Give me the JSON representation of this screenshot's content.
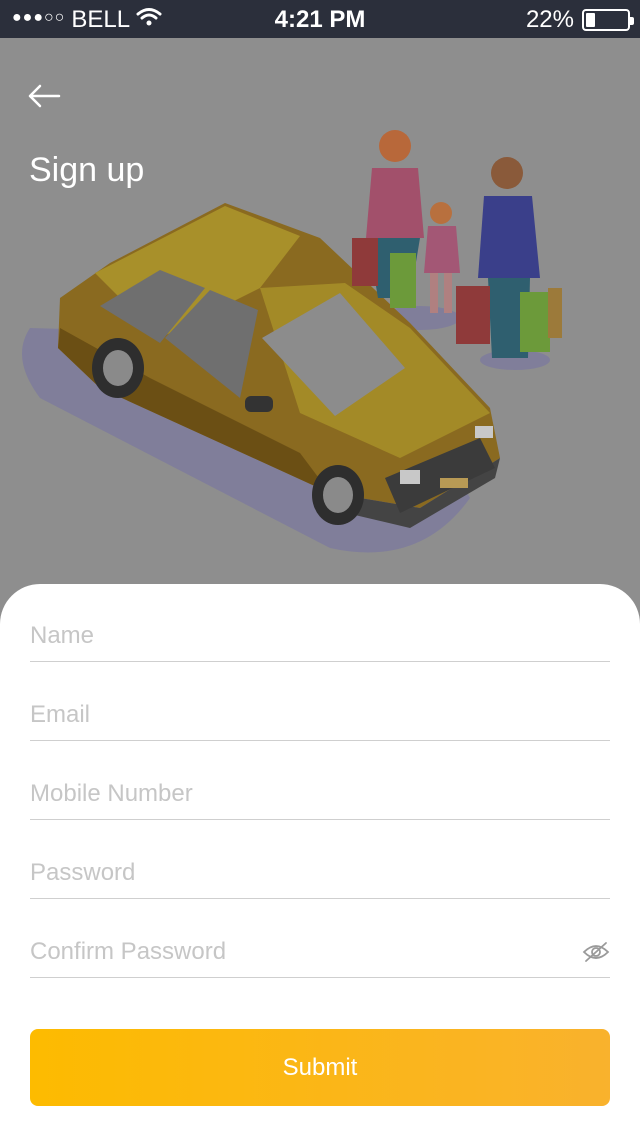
{
  "status_bar": {
    "signal_dots": "●●●○○",
    "carrier": "BELL",
    "wifi_icon": "wifi-icon",
    "time": "4:21 PM",
    "battery_text": "22%",
    "battery_level": 0.22
  },
  "header": {
    "back_icon": "arrow-left-icon",
    "title": "Sign up"
  },
  "form": {
    "name_placeholder": "Name",
    "email_placeholder": "Email",
    "mobile_placeholder": "Mobile Number",
    "password_placeholder": "Password",
    "confirm_password_placeholder": "Confirm Password",
    "visibility_icon": "eye-off-icon",
    "submit_label": "Submit"
  },
  "colors": {
    "accent": "#fdbb00",
    "status_bar": "#2b2f3b",
    "hero_overlay": "#8e8e8e",
    "placeholder": "#c6c6c6"
  }
}
